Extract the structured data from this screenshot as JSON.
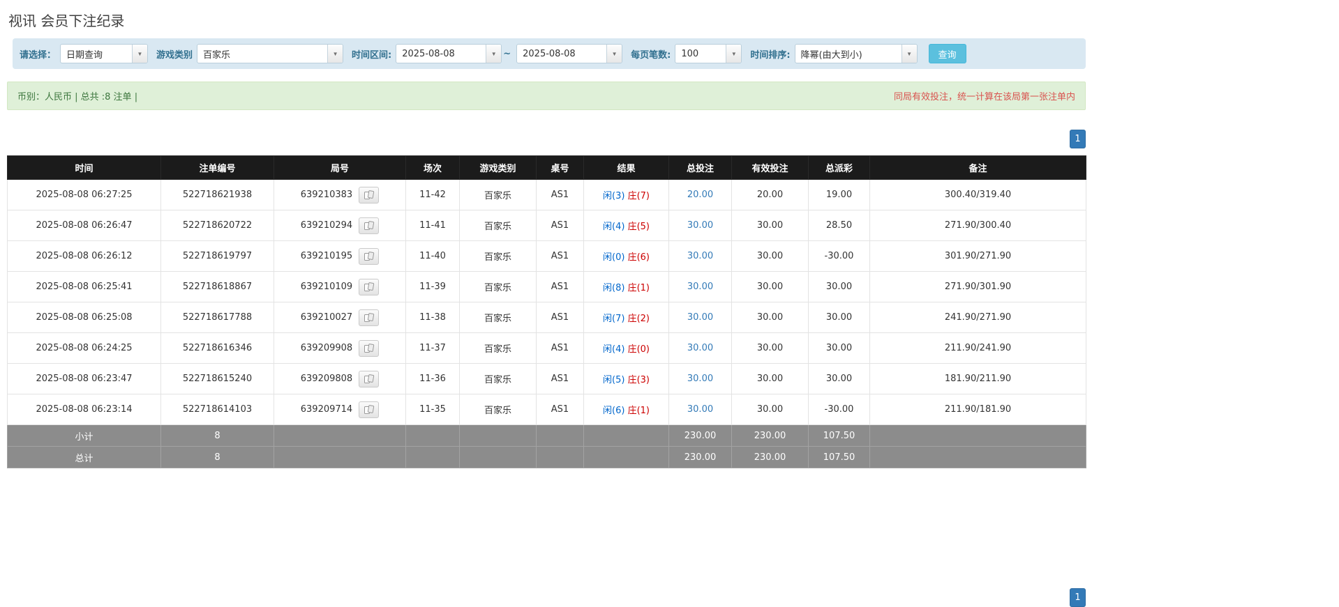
{
  "page": {
    "title": "视讯 会员下注纪录"
  },
  "filter": {
    "select_label": "请选择：",
    "select_value": "日期查询",
    "game_label": "游戏类别",
    "game_value": "百家乐",
    "range_label": "时间区间:",
    "date_from": "2025-08-08",
    "range_separator": "~",
    "date_to": "2025-08-08",
    "page_size_label": "每页笔数:",
    "page_size_value": "100",
    "sort_label": "时间排序:",
    "sort_value": "降幂(由大到小)",
    "search_button_label": "查询"
  },
  "summary": {
    "currency_info": "币别：人民币 | 总共 :8 注单 |",
    "notice": "同局有效投注，统一计算在该局第一张注单内"
  },
  "pagination": {
    "top_page": "1",
    "bottom_page": "1"
  },
  "colors": {
    "search_button": "#5bc0de",
    "pagination_button": "#337ab7",
    "player_blue": "#0066cc",
    "banker_red": "#cc0000",
    "negative_red": "#d9534f",
    "summary_green_bg": "#dff0d8",
    "summary_green_text": "#3c763d",
    "notice_red": "#d9534f",
    "header_black": "#1b1b1b",
    "footer_gray": "#8c8c8c"
  },
  "table": {
    "headers": [
      "时间",
      "注单编号",
      "局号",
      "场次",
      "游戏类别",
      "桌号",
      "结果",
      "总投注",
      "有效投注",
      "总派彩",
      "备注"
    ],
    "rows": [
      {
        "time": "2025-08-08 06:27:25",
        "bet_id": "522718621938",
        "round_id": "639210383",
        "session": "11-42",
        "game": "百家乐",
        "table_no": "AS1",
        "result_player": "闲(3)",
        "result_banker": "庄(7)",
        "total_bet": "20.00",
        "valid_bet": "20.00",
        "payout": "19.00",
        "note": "300.40/319.40"
      },
      {
        "time": "2025-08-08 06:26:47",
        "bet_id": "522718620722",
        "round_id": "639210294",
        "session": "11-41",
        "game": "百家乐",
        "table_no": "AS1",
        "result_player": "闲(4)",
        "result_banker": "庄(5)",
        "total_bet": "30.00",
        "valid_bet": "30.00",
        "payout": "28.50",
        "note": "271.90/300.40"
      },
      {
        "time": "2025-08-08 06:26:12",
        "bet_id": "522718619797",
        "round_id": "639210195",
        "session": "11-40",
        "game": "百家乐",
        "table_no": "AS1",
        "result_player": "闲(0)",
        "result_banker": "庄(6)",
        "total_bet": "30.00",
        "valid_bet": "30.00",
        "payout": "-30.00",
        "note": "301.90/271.90"
      },
      {
        "time": "2025-08-08 06:25:41",
        "bet_id": "522718618867",
        "round_id": "639210109",
        "session": "11-39",
        "game": "百家乐",
        "table_no": "AS1",
        "result_player": "闲(8)",
        "result_banker": "庄(1)",
        "total_bet": "30.00",
        "valid_bet": "30.00",
        "payout": "30.00",
        "note": "271.90/301.90"
      },
      {
        "time": "2025-08-08 06:25:08",
        "bet_id": "522718617788",
        "round_id": "639210027",
        "session": "11-38",
        "game": "百家乐",
        "table_no": "AS1",
        "result_player": "闲(7)",
        "result_banker": "庄(2)",
        "total_bet": "30.00",
        "valid_bet": "30.00",
        "payout": "30.00",
        "note": "241.90/271.90"
      },
      {
        "time": "2025-08-08 06:24:25",
        "bet_id": "522718616346",
        "round_id": "639209908",
        "session": "11-37",
        "game": "百家乐",
        "table_no": "AS1",
        "result_player": "闲(4)",
        "result_banker": "庄(0)",
        "total_bet": "30.00",
        "valid_bet": "30.00",
        "payout": "30.00",
        "note": "211.90/241.90"
      },
      {
        "time": "2025-08-08 06:23:47",
        "bet_id": "522718615240",
        "round_id": "639209808",
        "session": "11-36",
        "game": "百家乐",
        "table_no": "AS1",
        "result_player": "闲(5)",
        "result_banker": "庄(3)",
        "total_bet": "30.00",
        "valid_bet": "30.00",
        "payout": "30.00",
        "note": "181.90/211.90"
      },
      {
        "time": "2025-08-08 06:23:14",
        "bet_id": "522718614103",
        "round_id": "639209714",
        "session": "11-35",
        "game": "百家乐",
        "table_no": "AS1",
        "result_player": "闲(6)",
        "result_banker": "庄(1)",
        "total_bet": "30.00",
        "valid_bet": "30.00",
        "payout": "-30.00",
        "note": "211.90/181.90"
      }
    ],
    "subtotal": {
      "label": "小计",
      "count": "8",
      "total_bet": "230.00",
      "valid_bet": "230.00",
      "payout": "107.50"
    },
    "total": {
      "label": "总计",
      "count": "8",
      "total_bet": "230.00",
      "valid_bet": "230.00",
      "payout": "107.50"
    }
  }
}
